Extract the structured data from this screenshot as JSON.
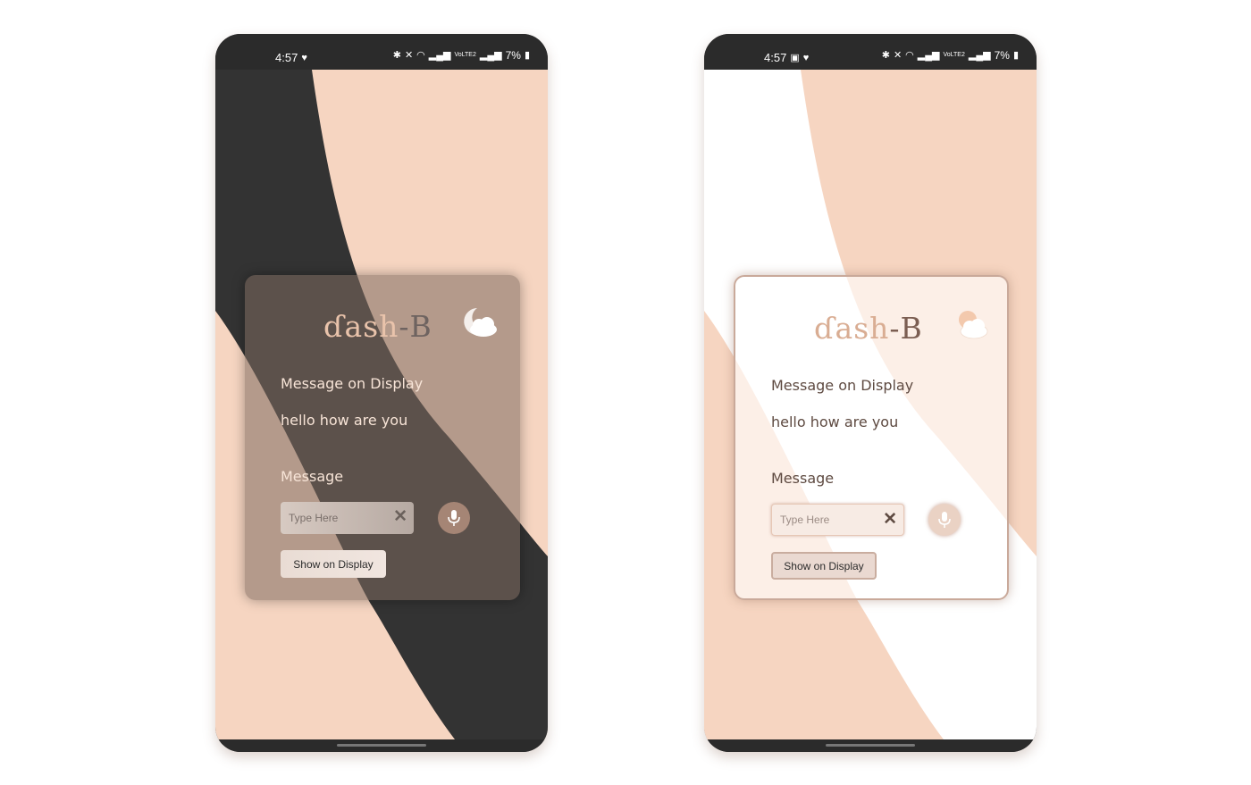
{
  "colors": {
    "peach": "#f6d5c1",
    "dark": "#333333",
    "statusbar": "#2b2b2b",
    "accent_brown": "#a58575"
  },
  "screens": [
    {
      "theme": "dark",
      "status_bar": {
        "time": "4:57",
        "battery": "7%",
        "network": "VoLTE2"
      },
      "logo": {
        "part1": "ɗash",
        "part2": "-B"
      },
      "weather_icon": "moon-cloud-icon",
      "display_label": "Message on Display",
      "display_value": "hello how are you",
      "message_label": "Message",
      "input": {
        "placeholder": "Type Here",
        "clear_icon": "close-icon"
      },
      "mic_icon": "microphone-icon",
      "button_label": "Show on Display"
    },
    {
      "theme": "light",
      "status_bar": {
        "time": "4:57",
        "battery": "7%",
        "network": "VoLTE2"
      },
      "logo": {
        "part1": "ɗash",
        "part2": "-B"
      },
      "weather_icon": "sun-cloud-icon",
      "display_label": "Message on Display",
      "display_value": "hello how are you",
      "message_label": "Message",
      "input": {
        "placeholder": "Type Here",
        "clear_icon": "close-icon"
      },
      "mic_icon": "microphone-icon",
      "button_label": "Show on Display"
    }
  ]
}
